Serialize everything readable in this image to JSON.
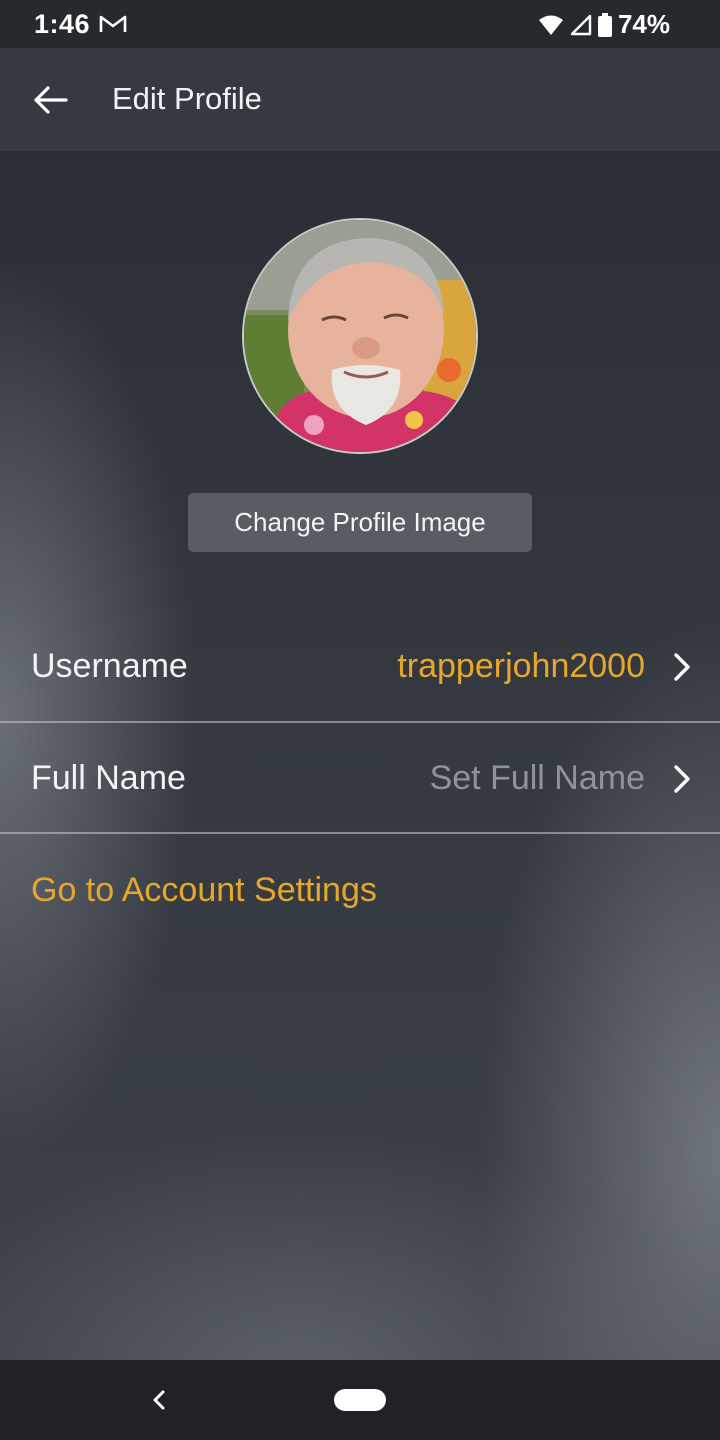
{
  "status_bar": {
    "time": "1:46",
    "notification_icon": "gmail-icon",
    "battery_percent": "74%",
    "icons": [
      "wifi-icon",
      "cellular-signal-icon",
      "battery-icon"
    ]
  },
  "app_bar": {
    "back_icon": "arrow-back-icon",
    "title": "Edit Profile"
  },
  "profile": {
    "avatar": "profile-photo",
    "change_image_label": "Change Profile Image"
  },
  "fields": {
    "username": {
      "label": "Username",
      "value": "trapperjohn2000"
    },
    "full_name": {
      "label": "Full Name",
      "placeholder": "Set Full Name"
    }
  },
  "account_link": "Go to Account Settings",
  "nav_bar": {
    "back_icon": "nav-back-icon",
    "home_icon": "nav-home-pill"
  },
  "colors": {
    "accent": "#e7a72b",
    "app_bar": "#353a42",
    "status_bar": "#26292e",
    "nav_bar": "#202226"
  }
}
